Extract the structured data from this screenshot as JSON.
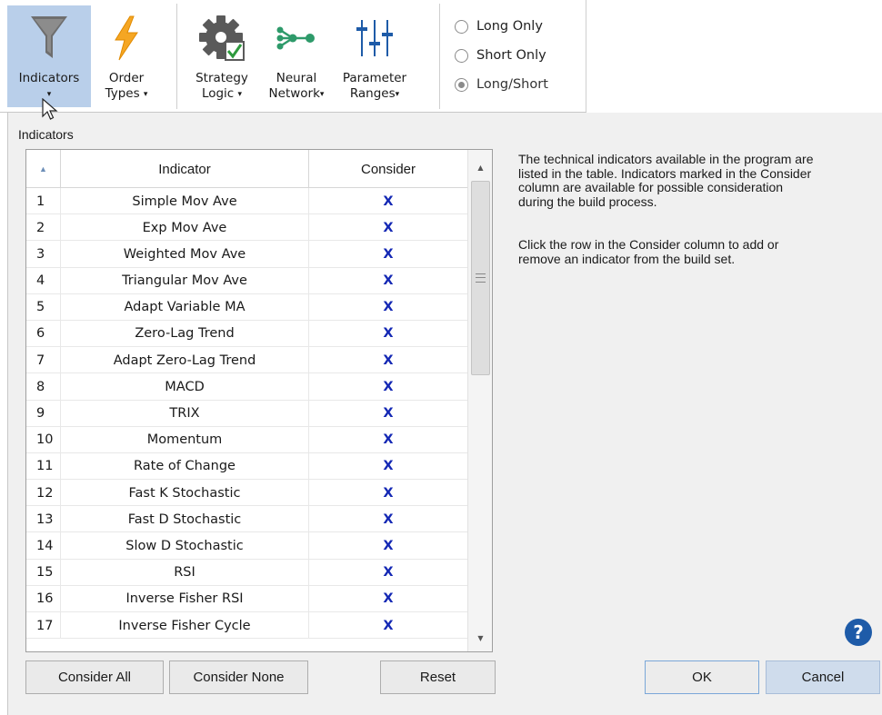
{
  "ribbon": {
    "buttons": [
      {
        "id": "indicators",
        "label": "Indicators",
        "label2": "",
        "icon": "filter-icon",
        "active": true
      },
      {
        "id": "order-types",
        "label": "Order",
        "label2": "Types",
        "icon": "lightning-icon",
        "active": false
      },
      {
        "id": "strategy-logic",
        "label": "Strategy",
        "label2": "Logic",
        "icon": "gear-check-icon",
        "active": false
      },
      {
        "id": "neural-network",
        "label": "Neural",
        "label2": "Network",
        "icon": "neural-network-icon",
        "active": false
      },
      {
        "id": "parameter-ranges",
        "label": "Parameter",
        "label2": "Ranges",
        "icon": "sliders-icon",
        "active": false
      }
    ],
    "dropdown_caret": "▾",
    "trade_direction": {
      "options": [
        "Long Only",
        "Short Only",
        "Long/Short"
      ],
      "selected": "Long/Short"
    }
  },
  "panel": {
    "section_label": "Indicators",
    "table": {
      "headers": {
        "sort": "▲",
        "indicator": "Indicator",
        "consider": "Consider"
      },
      "rows": [
        {
          "num": "1",
          "indicator": "Simple Mov Ave",
          "consider": "X"
        },
        {
          "num": "2",
          "indicator": "Exp Mov Ave",
          "consider": "X"
        },
        {
          "num": "3",
          "indicator": "Weighted Mov Ave",
          "consider": "X"
        },
        {
          "num": "4",
          "indicator": "Triangular Mov Ave",
          "consider": "X"
        },
        {
          "num": "5",
          "indicator": "Adapt Variable MA",
          "consider": "X"
        },
        {
          "num": "6",
          "indicator": "Zero-Lag Trend",
          "consider": "X"
        },
        {
          "num": "7",
          "indicator": "Adapt Zero-Lag Trend",
          "consider": "X"
        },
        {
          "num": "8",
          "indicator": "MACD",
          "consider": "X"
        },
        {
          "num": "9",
          "indicator": "TRIX",
          "consider": "X"
        },
        {
          "num": "10",
          "indicator": "Momentum",
          "consider": "X"
        },
        {
          "num": "11",
          "indicator": "Rate of Change",
          "consider": "X"
        },
        {
          "num": "12",
          "indicator": "Fast K Stochastic",
          "consider": "X"
        },
        {
          "num": "13",
          "indicator": "Fast D Stochastic",
          "consider": "X"
        },
        {
          "num": "14",
          "indicator": "Slow D Stochastic",
          "consider": "X"
        },
        {
          "num": "15",
          "indicator": "RSI",
          "consider": "X"
        },
        {
          "num": "16",
          "indicator": "Inverse Fisher RSI",
          "consider": "X"
        },
        {
          "num": "17",
          "indicator": "Inverse Fisher Cycle",
          "consider": "X"
        }
      ]
    },
    "description": [
      "The technical indicators available in the program are listed in the table. Indicators marked in the Consider column are available for possible consideration during the build process.",
      "Click the row in the Consider column to add or remove an indicator from the build set."
    ],
    "buttons": {
      "consider_all": "Consider All",
      "consider_none": "Consider None",
      "reset": "Reset",
      "ok": "OK",
      "cancel": "Cancel"
    },
    "help_glyph": "?"
  },
  "colors": {
    "active_ribbon": "#b9cfea",
    "consider_mark": "#1428b4",
    "help": "#1e5ba8"
  }
}
